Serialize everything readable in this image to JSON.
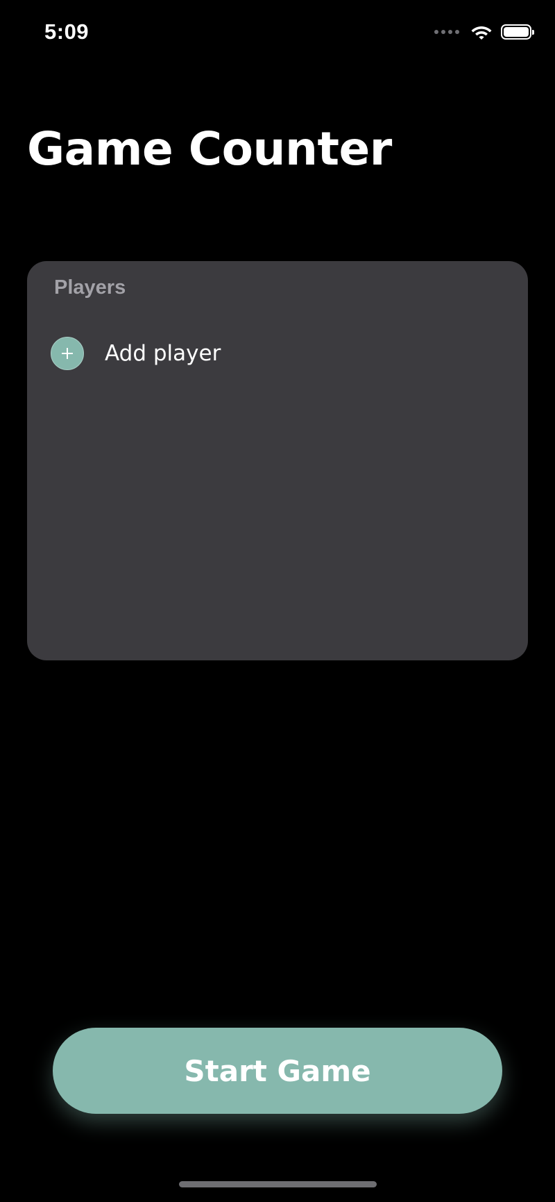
{
  "status_bar": {
    "time": "5:09",
    "icons": [
      "signal-dots-icon",
      "wifi-icon",
      "battery-icon"
    ]
  },
  "header": {
    "title": "Game Counter"
  },
  "players_card": {
    "header": "Players",
    "add_player": {
      "icon": "plus-icon",
      "label": "Add player"
    },
    "players": []
  },
  "footer": {
    "start_label": "Start Game"
  },
  "colors": {
    "background": "#000000",
    "card": "#3c3b3f",
    "accent": "#86b8ad",
    "secondary_text": "#a3a2a8",
    "text": "#ffffff"
  }
}
